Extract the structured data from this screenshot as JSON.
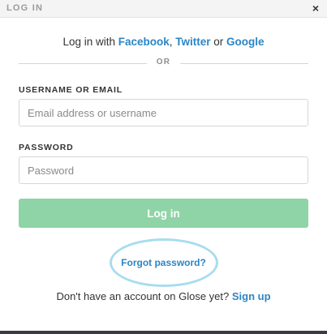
{
  "header": {
    "title": "LOG IN",
    "close_glyph": "×"
  },
  "social": {
    "prefix": "Log in with ",
    "facebook": "Facebook",
    "sep1": ", ",
    "twitter": "Twitter",
    "sep2": " or ",
    "google": "Google"
  },
  "divider_text": "OR",
  "username": {
    "label": "USERNAME OR EMAIL",
    "placeholder": "Email address or username",
    "value": ""
  },
  "password": {
    "label": "PASSWORD",
    "placeholder": "Password",
    "value": ""
  },
  "login_button": "Log in",
  "forgot_password": "Forgot password?",
  "signup": {
    "prefix": "Don't have an account on Glose yet? ",
    "link": "Sign up"
  },
  "colors": {
    "link_blue": "#2b86c5",
    "button_green": "#8fd4a6",
    "highlight_circle": "#a8dcf0"
  },
  "icons": {
    "close": "close-icon"
  }
}
